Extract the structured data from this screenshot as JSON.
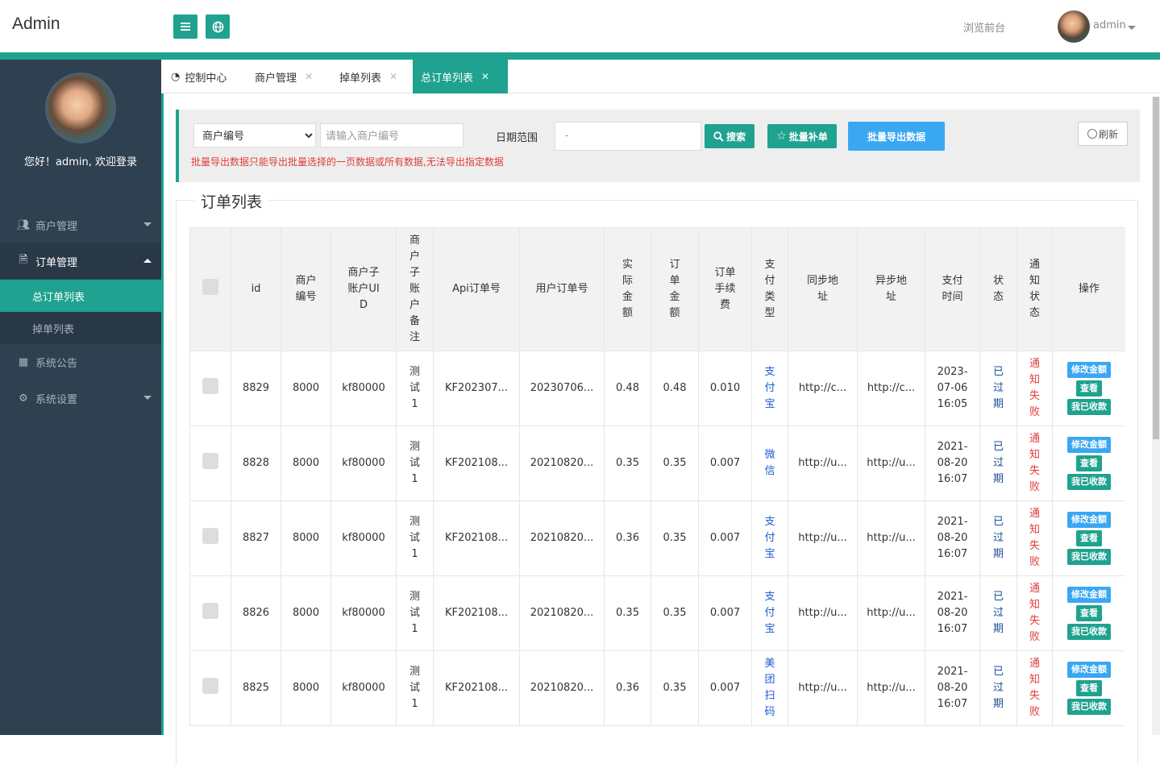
{
  "app": {
    "brand": "Admin",
    "front_link": "浏览前台",
    "user": "admin"
  },
  "sidebar": {
    "welcome": "您好！admin, 欢迎登录",
    "items": [
      {
        "label": "商户管理",
        "icon": "users-icon"
      },
      {
        "label": "订单管理",
        "icon": "file-icon"
      },
      {
        "label": "总订单列表"
      },
      {
        "label": "掉单列表"
      },
      {
        "label": "系统公告",
        "icon": "grid-icon"
      },
      {
        "label": "系统设置",
        "icon": "cogs-icon"
      }
    ]
  },
  "tabs": [
    {
      "label": "控制中心"
    },
    {
      "label": "商户管理"
    },
    {
      "label": "掉单列表"
    },
    {
      "label": "总订单列表"
    }
  ],
  "filter": {
    "select_value": "商户编号",
    "input_placeholder": "请输入商户编号",
    "date_label": "日期范围",
    "date_value": "-",
    "search_btn": "搜索",
    "batch_btn": "批量补单",
    "export_btn": "批量导出数据",
    "refresh_btn": "刷新",
    "note": "批量导出数据只能导出批量选择的一页数据或所有数据,无法导出指定数据"
  },
  "section_title": "订单列表",
  "table": {
    "headers": [
      "",
      "id",
      "商户编号",
      "商户子账户UID",
      "商户子账户备注",
      "Api订单号",
      "用户订单号",
      "实际金额",
      "订单金额",
      "订单手续费",
      "支付类型",
      "同步地址",
      "异步地址",
      "支付时间",
      "状态",
      "通知状态",
      "操作"
    ],
    "rows": [
      {
        "id": "8829",
        "mch": "8000",
        "uid": "kf80000",
        "note": "测试1",
        "api": "KF202307...",
        "user_order": "20230706...",
        "actual": "0.48",
        "amount": "0.48",
        "fee": "0.010",
        "pay": "支付宝",
        "sync": "http://c...",
        "async": "http://c...",
        "time": "2023-07-06 16:05",
        "status": "已过期",
        "notify": "通知失败"
      },
      {
        "id": "8828",
        "mch": "8000",
        "uid": "kf80000",
        "note": "测试1",
        "api": "KF202108...",
        "user_order": "20210820...",
        "actual": "0.35",
        "amount": "0.35",
        "fee": "0.007",
        "pay": "微信",
        "sync": "http://u...",
        "async": "http://u...",
        "time": "2021-08-20 16:07",
        "status": "已过期",
        "notify": "通知失败"
      },
      {
        "id": "8827",
        "mch": "8000",
        "uid": "kf80000",
        "note": "测试1",
        "api": "KF202108...",
        "user_order": "20210820...",
        "actual": "0.36",
        "amount": "0.35",
        "fee": "0.007",
        "pay": "支付宝",
        "sync": "http://u...",
        "async": "http://u...",
        "time": "2021-08-20 16:07",
        "status": "已过期",
        "notify": "通知失败"
      },
      {
        "id": "8826",
        "mch": "8000",
        "uid": "kf80000",
        "note": "测试1",
        "api": "KF202108...",
        "user_order": "20210820...",
        "actual": "0.35",
        "amount": "0.35",
        "fee": "0.007",
        "pay": "支付宝",
        "sync": "http://u...",
        "async": "http://u...",
        "time": "2021-08-20 16:07",
        "status": "已过期",
        "notify": "通知失败"
      },
      {
        "id": "8825",
        "mch": "8000",
        "uid": "kf80000",
        "note": "测试1",
        "api": "KF202108...",
        "user_order": "20210820...",
        "actual": "0.36",
        "amount": "0.35",
        "fee": "0.007",
        "pay": "美团扫码",
        "sync": "http://u...",
        "async": "http://u...",
        "time": "2021-08-20 16:07",
        "status": "已过期",
        "notify": "通知失败"
      }
    ],
    "ops": [
      "修改金额",
      "查看",
      "我已收款"
    ]
  },
  "colors": {
    "accent": "#1fa28f",
    "sidebar": "#2f4050",
    "blue_btn": "#3aa7f2",
    "danger": "#e03c3c",
    "link": "#1e5ad6"
  }
}
